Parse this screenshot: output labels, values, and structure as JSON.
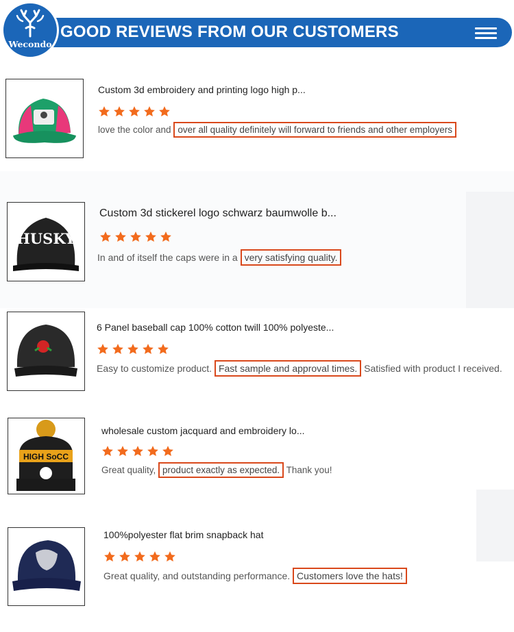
{
  "header": {
    "title": "GOOD REVIEWS FROM OUR CUSTOMERS",
    "logo_text": "Wecondo",
    "menu_icon": "hamburger-menu-icon",
    "accent_color": "#1b66b8"
  },
  "highlight_color": "#d9481b",
  "star_color": "#f26b1d",
  "reviews": [
    {
      "title": "Custom 3d embroidery and printing logo high p...",
      "rating": 5,
      "text_before": "love the color and ",
      "text_highlight": "over all quality definitely will forward to friends and other employers",
      "text_after": ""
    },
    {
      "title": "Custom 3d stickerel logo schwarz baumwolle b...",
      "rating": 5,
      "text_before": "In and of itself the caps were in a ",
      "text_highlight": "very satisfying quality.",
      "text_after": ""
    },
    {
      "title": "6 Panel baseball cap 100% cotton twill 100% polyeste...",
      "rating": 5,
      "text_before": "Easy to customize product. ",
      "text_highlight": "Fast sample and approval times.",
      "text_after": " Satisfied with product I received."
    },
    {
      "title": "wholesale custom jacquard and embroidery lo...",
      "rating": 5,
      "text_before": "Great quality, ",
      "text_highlight": "product exactly as expected.",
      "text_after": " Thank you!"
    },
    {
      "title": "100%polyester flat brim snapback hat",
      "rating": 5,
      "text_before": "Great quality, and outstanding performance. ",
      "text_highlight": "Customers love the hats!",
      "text_after": ""
    }
  ]
}
